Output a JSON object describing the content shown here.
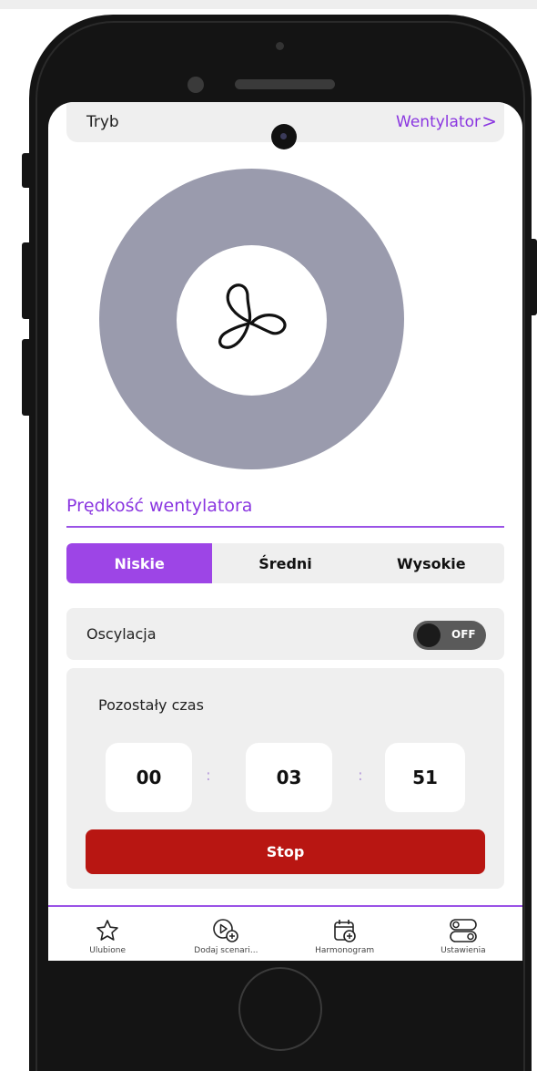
{
  "header": {
    "mode_label": "Tryb",
    "mode_value": "Wentylator",
    "mode_chevron": ">"
  },
  "fan": {
    "icon": "fan-icon",
    "ring_color": "#9a9bad"
  },
  "speed": {
    "title": "Prędkość wentylatora",
    "options": [
      "Niskie",
      "Średni",
      "Wysokie"
    ],
    "selected": "Niskie"
  },
  "oscillation": {
    "label": "Oscylacja",
    "toggle_text": "OFF",
    "state": "off"
  },
  "timer": {
    "title": "Pozostały czas",
    "hours": "00",
    "minutes": "03",
    "seconds": "51",
    "separator": ":",
    "stop_label": "Stop"
  },
  "nav": {
    "items": [
      {
        "label": "Ulubione",
        "icon": "star-icon"
      },
      {
        "label": "Dodaj scenari...",
        "icon": "add-scenario-icon"
      },
      {
        "label": "Harmonogram",
        "icon": "calendar-add-icon"
      },
      {
        "label": "Ustawienia",
        "icon": "toggles-icon"
      }
    ]
  },
  "colors": {
    "accent": "#9d45e6",
    "stop": "#b81612",
    "card": "#efefef"
  }
}
